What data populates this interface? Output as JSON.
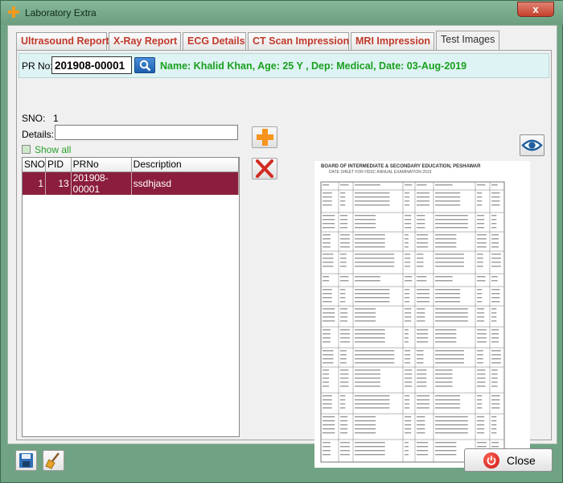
{
  "window": {
    "title": "Laboratory Extra",
    "close_glyph": "x"
  },
  "tabs": [
    {
      "label": "Ultrasound Report"
    },
    {
      "label": "X-Ray Report"
    },
    {
      "label": "ECG Details"
    },
    {
      "label": "CT Scan Impression"
    },
    {
      "label": "MRI Impression"
    },
    {
      "label": "Test Images",
      "active": true
    }
  ],
  "pr": {
    "label": "PR No:",
    "value": "201908-00001",
    "patient_info": "Name: Khalid Khan,  Age: 25 Y       , Dep: Medical, Date: 03-Aug-2019"
  },
  "form": {
    "sno_label": "SNO:",
    "sno_value": "1",
    "details_label": "Details:",
    "details_value": "",
    "show_all_label": "Show all"
  },
  "grid": {
    "columns": [
      "SNO",
      "PID",
      "PRNo",
      "Description"
    ],
    "rows": [
      {
        "sno": "1",
        "pid": "13",
        "prno": "201908-00001",
        "description": "ssdhjasd"
      }
    ]
  },
  "document": {
    "title": "BOARD OF INTERMEDIATE & SECONDARY EDUCATION, PESHAWAR",
    "subtitle": "DATE SHEET FOR HSSC ANNUAL EXAMINATION 2019"
  },
  "footer": {
    "close_label": "Close"
  },
  "colors": {
    "accent_green": "#19a01f",
    "selected_row": "#8b1e3c",
    "tab_text": "#c0392b",
    "pr_bar": "#def3f3"
  }
}
